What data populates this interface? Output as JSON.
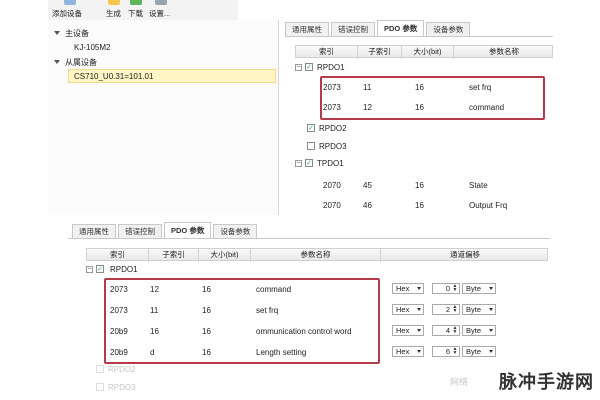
{
  "toolbar": {
    "add_device": "添加设备",
    "generate": "生成",
    "download": "下载",
    "settings": "设置..."
  },
  "tree": {
    "items": [
      {
        "label": "主设备",
        "level": 0
      },
      {
        "label": "KJ-105M2",
        "level": 1
      },
      {
        "label": "从属设备",
        "level": 0
      },
      {
        "label": "CS710_U0.31=101.01",
        "level": 1
      }
    ]
  },
  "top_panel": {
    "tabs": [
      "通用属性",
      "错误控制",
      "PDO 参数",
      "设备参数"
    ],
    "active_tab": 2,
    "columns": [
      "索引",
      "子索引",
      "大小(bit)",
      "参数名称"
    ],
    "groups": [
      {
        "name": "RPDO1",
        "rows": [
          {
            "index": "2073",
            "sub": "11",
            "size": "16",
            "name": "set frq"
          },
          {
            "index": "2073",
            "sub": "12",
            "size": "16",
            "name": "command"
          }
        ]
      },
      {
        "name": "RPDO2"
      },
      {
        "name": "RPDO3"
      },
      {
        "name": "TPDO1",
        "rows": [
          {
            "index": "2070",
            "sub": "45",
            "size": "16",
            "name": "State"
          },
          {
            "index": "2070",
            "sub": "46",
            "size": "16",
            "name": "Output Frq"
          }
        ]
      }
    ]
  },
  "bottom_panel": {
    "tabs": [
      "通用属性",
      "错误控制",
      "PDO 参数",
      "设备参数"
    ],
    "active_tab": 2,
    "columns": [
      "索引",
      "子索引",
      "大小(bit)",
      "参数名称",
      "通道偏移"
    ],
    "group_name": "RPDO1",
    "rows": [
      {
        "index": "2073",
        "sub": "12",
        "size": "16",
        "name": "command",
        "format": "Hex",
        "offset": "0",
        "unit": "Byte"
      },
      {
        "index": "2073",
        "sub": "11",
        "size": "16",
        "name": "set frq",
        "format": "Hex",
        "offset": "2",
        "unit": "Byte"
      },
      {
        "index": "20b9",
        "sub": "16",
        "size": "16",
        "name": "ommunication control word",
        "format": "Hex",
        "offset": "4",
        "unit": "Byte"
      },
      {
        "index": "20b9",
        "sub": "d",
        "size": "16",
        "name": "Length setting",
        "format": "Hex",
        "offset": "6",
        "unit": "Byte"
      }
    ],
    "faded_groups": [
      "RPDO2",
      "RPDO3"
    ]
  },
  "watermark": {
    "main": "脉冲手游网",
    "small": "网络"
  },
  "colors": {
    "highlight_box": "#b23a4a",
    "checkmark": "#11bb55",
    "selected_bg": "#fff4c4"
  }
}
